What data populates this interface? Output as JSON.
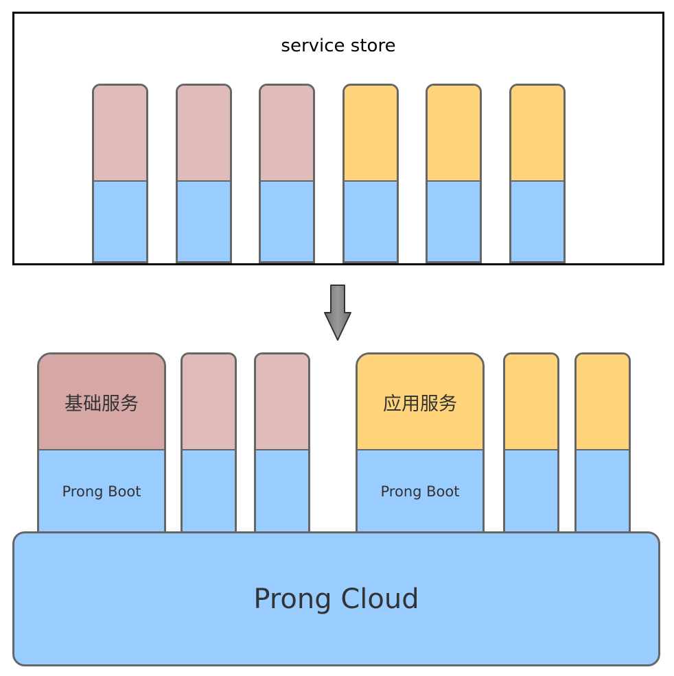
{
  "service_store": {
    "title": "service store",
    "columns": [
      {
        "top_color": "#dfbbb9",
        "kind": "basic-service"
      },
      {
        "top_color": "#dfbbb9",
        "kind": "basic-service"
      },
      {
        "top_color": "#dfbbb9",
        "kind": "basic-service"
      },
      {
        "top_color": "#ffd37a",
        "kind": "app-service"
      },
      {
        "top_color": "#ffd37a",
        "kind": "app-service"
      },
      {
        "top_color": "#ffd37a",
        "kind": "app-service"
      }
    ]
  },
  "deployed": {
    "basic_service_label": "基础服务",
    "app_service_label": "应用服务",
    "boot_label": "Prong Boot"
  },
  "platform": {
    "label": "Prong Cloud"
  },
  "colors": {
    "basic_service": "#dfbbb9",
    "basic_service_highlight": "#d5a7a5",
    "app_service": "#ffd37a",
    "runtime": "#99ccff",
    "outline": "#666666",
    "arrow": "#888888"
  },
  "icons": {
    "flow_arrow": "down-arrow-icon"
  }
}
